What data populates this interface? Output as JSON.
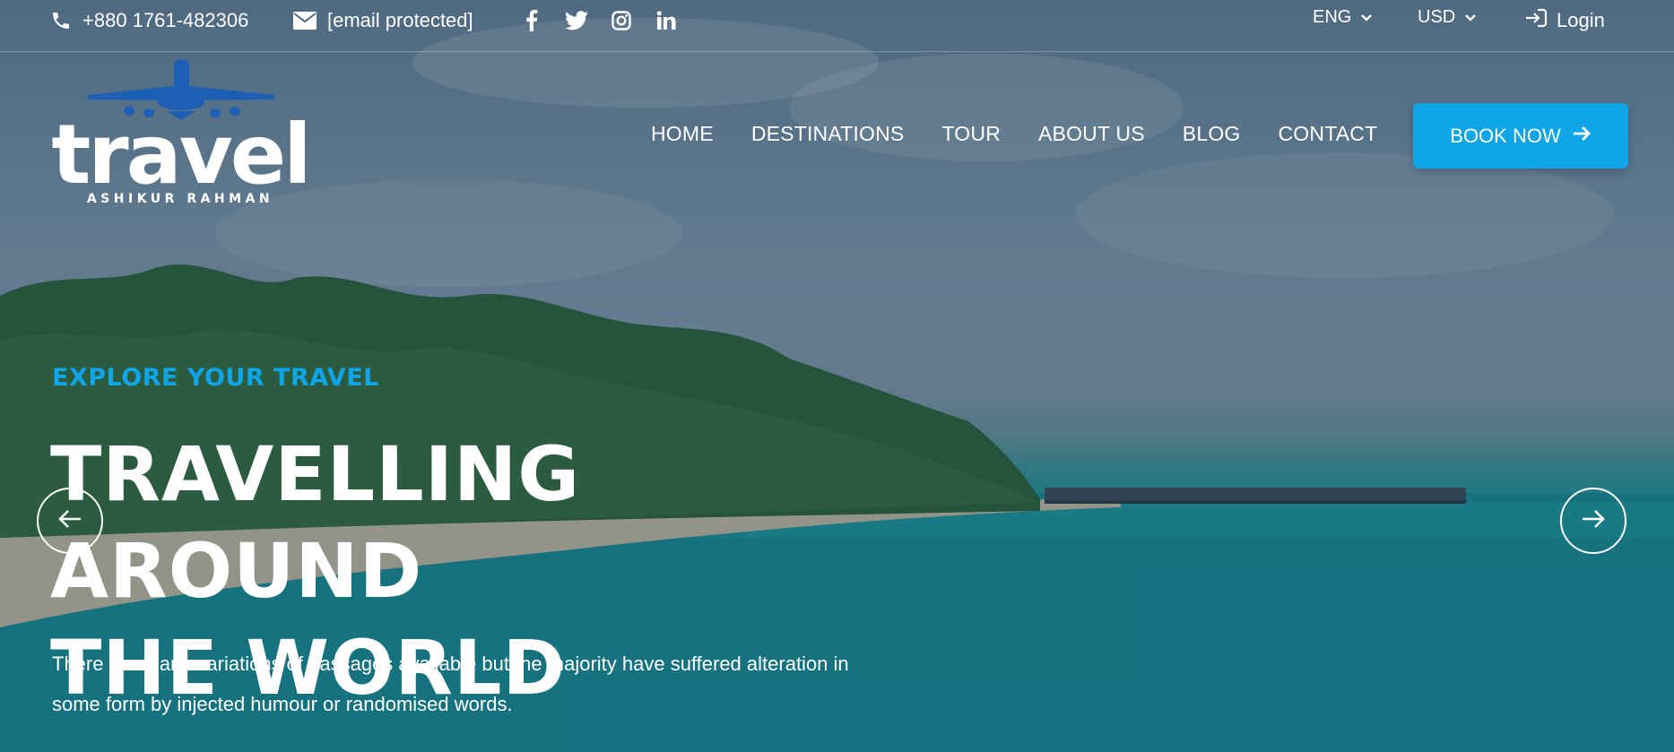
{
  "topbar": {
    "phone": "+880 1761-482306",
    "email": "[email protected]",
    "social_icons": [
      "facebook-icon",
      "twitter-icon",
      "instagram-icon",
      "linkedin-icon"
    ],
    "language": "ENG",
    "currency": "USD",
    "login_label": "Login"
  },
  "logo": {
    "word": "travel",
    "tagline": "ASHIKUR RAHMAN"
  },
  "nav": {
    "items": [
      "HOME",
      "DESTINATIONS",
      "TOUR",
      "ABOUT US",
      "BLOG",
      "CONTACT"
    ],
    "book_label": "BOOK NOW"
  },
  "hero": {
    "eyebrow": "EXPLORE YOUR TRAVEL",
    "headline_line1": "TRAVELLING AROUND",
    "headline_line2": "THE WORLD",
    "description_line1": "There are many variations of passages available but the majority have suffered alteration in",
    "description_line2": "some form by injected humour or randomised words."
  },
  "colors": {
    "accent": "#0ea5e9",
    "text": "#ffffff"
  }
}
